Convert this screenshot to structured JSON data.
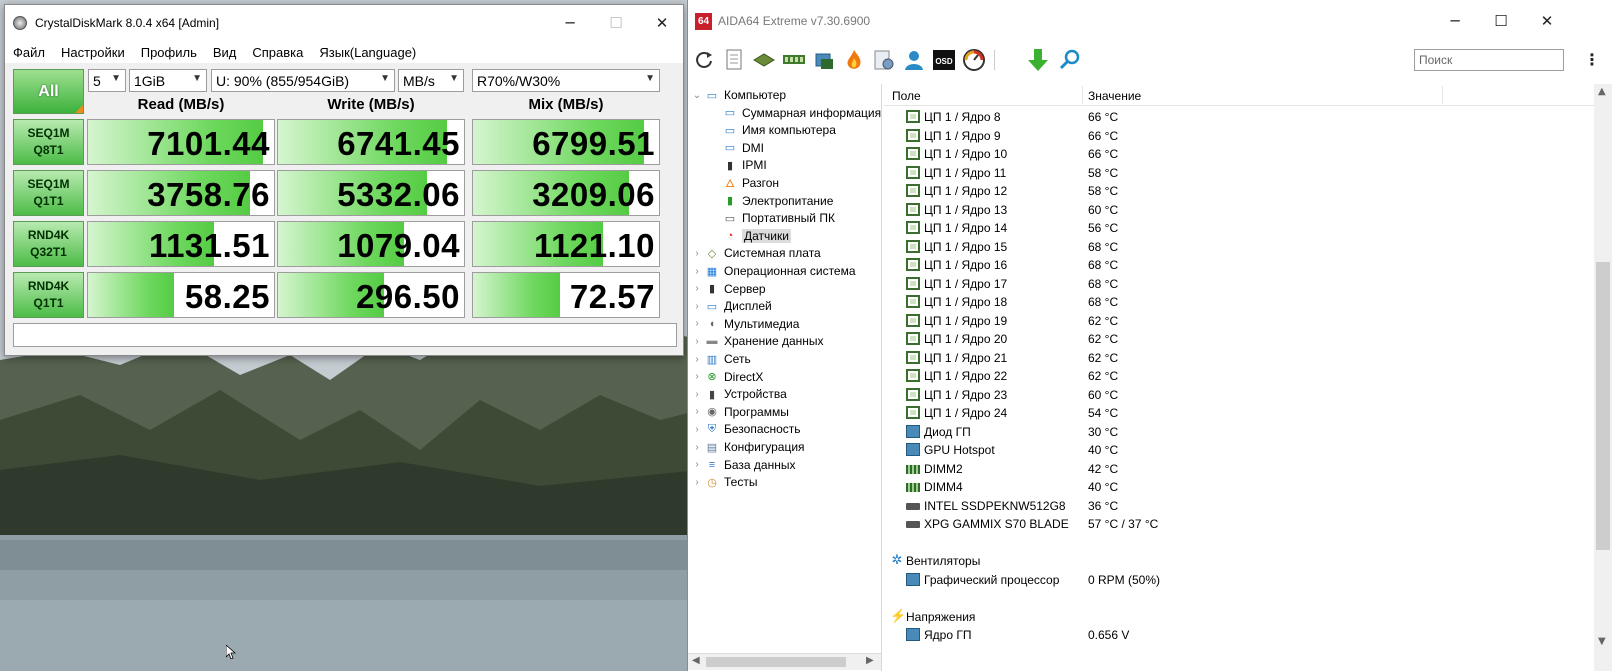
{
  "cdm": {
    "title": "CrystalDiskMark 8.0.4 x64 [Admin]",
    "menu": [
      "Файл",
      "Настройки",
      "Профиль",
      "Вид",
      "Справка",
      "Язык(Language)"
    ],
    "all_label": "All",
    "count": "5",
    "size": "1GiB",
    "drive": "U: 90% (855/954GiB)",
    "unit": "MB/s",
    "profile": "R70%/W30%",
    "columns": [
      "Read (MB/s)",
      "Write (MB/s)",
      "Mix (MB/s)"
    ],
    "rows": [
      {
        "l1": "SEQ1M",
        "l2": "Q8T1",
        "read": "7101.44",
        "write": "6741.45",
        "mix": "6799.51",
        "read_fill": 0.94,
        "write_fill": 0.91,
        "mix_fill": 0.92
      },
      {
        "l1": "SEQ1M",
        "l2": "Q1T1",
        "read": "3758.76",
        "write": "5332.06",
        "mix": "3209.06",
        "read_fill": 0.87,
        "write_fill": 0.8,
        "mix_fill": 0.84
      },
      {
        "l1": "RND4K",
        "l2": "Q32T1",
        "read": "1131.51",
        "write": "1079.04",
        "mix": "1121.10",
        "read_fill": 0.68,
        "write_fill": 0.68,
        "mix_fill": 0.7
      },
      {
        "l1": "RND4K",
        "l2": "Q1T1",
        "read": "58.25",
        "write": "296.50",
        "mix": "72.57",
        "read_fill": 0.46,
        "write_fill": 0.57,
        "mix_fill": 0.47
      }
    ],
    "status": ""
  },
  "aida": {
    "title": "AIDA64 Extreme v7.30.6900",
    "logo": "64",
    "search_placeholder": "Поиск",
    "tree": [
      {
        "label": "Компьютер",
        "level": 0,
        "expanded": true,
        "icon": "computer-icon"
      },
      {
        "label": "Суммарная информация",
        "level": 1,
        "icon": "computer-icon"
      },
      {
        "label": "Имя компьютера",
        "level": 1,
        "icon": "computer-icon"
      },
      {
        "label": "DMI",
        "level": 1,
        "icon": "computer-icon"
      },
      {
        "label": "IPMI",
        "level": 1,
        "icon": "server-icon"
      },
      {
        "label": "Разгон",
        "level": 1,
        "icon": "flame-icon"
      },
      {
        "label": "Электропитание",
        "level": 1,
        "icon": "battery-icon"
      },
      {
        "label": "Портативный ПК",
        "level": 1,
        "icon": "laptop-icon"
      },
      {
        "label": "Датчики",
        "level": 1,
        "icon": "gauge-icon",
        "selected": true
      },
      {
        "label": "Системная плата",
        "level": 0,
        "icon": "motherboard-icon"
      },
      {
        "label": "Операционная система",
        "level": 0,
        "icon": "windows-icon"
      },
      {
        "label": "Сервер",
        "level": 0,
        "icon": "server-icon"
      },
      {
        "label": "Дисплей",
        "level": 0,
        "icon": "monitor-icon"
      },
      {
        "label": "Мультимедиа",
        "level": 0,
        "icon": "speaker-icon"
      },
      {
        "label": "Хранение данных",
        "level": 0,
        "icon": "drive-icon"
      },
      {
        "label": "Сеть",
        "level": 0,
        "icon": "network-icon"
      },
      {
        "label": "DirectX",
        "level": 0,
        "icon": "xbox-icon"
      },
      {
        "label": "Устройства",
        "level": 0,
        "icon": "device-icon"
      },
      {
        "label": "Программы",
        "level": 0,
        "icon": "disc-icon"
      },
      {
        "label": "Безопасность",
        "level": 0,
        "icon": "shield-icon"
      },
      {
        "label": "Конфигурация",
        "level": 0,
        "icon": "config-icon"
      },
      {
        "label": "База данных",
        "level": 0,
        "icon": "database-icon"
      },
      {
        "label": "Тесты",
        "level": 0,
        "icon": "timer-icon"
      }
    ],
    "col_field": "Поле",
    "col_value": "Значение",
    "rows": [
      {
        "f": "ЦП 1 / Ядро 8",
        "v": "66 °C",
        "t": "chip"
      },
      {
        "f": "ЦП 1 / Ядро 9",
        "v": "66 °C",
        "t": "chip"
      },
      {
        "f": "ЦП 1 / Ядро 10",
        "v": "66 °C",
        "t": "chip"
      },
      {
        "f": "ЦП 1 / Ядро 11",
        "v": "58 °C",
        "t": "chip"
      },
      {
        "f": "ЦП 1 / Ядро 12",
        "v": "58 °C",
        "t": "chip"
      },
      {
        "f": "ЦП 1 / Ядро 13",
        "v": "60 °C",
        "t": "chip"
      },
      {
        "f": "ЦП 1 / Ядро 14",
        "v": "56 °C",
        "t": "chip"
      },
      {
        "f": "ЦП 1 / Ядро 15",
        "v": "68 °C",
        "t": "chip"
      },
      {
        "f": "ЦП 1 / Ядро 16",
        "v": "68 °C",
        "t": "chip"
      },
      {
        "f": "ЦП 1 / Ядро 17",
        "v": "68 °C",
        "t": "chip"
      },
      {
        "f": "ЦП 1 / Ядро 18",
        "v": "68 °C",
        "t": "chip"
      },
      {
        "f": "ЦП 1 / Ядро 19",
        "v": "62 °C",
        "t": "chip"
      },
      {
        "f": "ЦП 1 / Ядро 20",
        "v": "62 °C",
        "t": "chip"
      },
      {
        "f": "ЦП 1 / Ядро 21",
        "v": "62 °C",
        "t": "chip"
      },
      {
        "f": "ЦП 1 / Ядро 22",
        "v": "62 °C",
        "t": "chip"
      },
      {
        "f": "ЦП 1 / Ядро 23",
        "v": "60 °C",
        "t": "chip"
      },
      {
        "f": "ЦП 1 / Ядро 24",
        "v": "54 °C",
        "t": "chip"
      },
      {
        "f": "Диод ГП",
        "v": "30 °C",
        "t": "gpu"
      },
      {
        "f": "GPU Hotspot",
        "v": "40 °C",
        "t": "gpu"
      },
      {
        "f": "DIMM2",
        "v": "42 °C",
        "t": "ram"
      },
      {
        "f": "DIMM4",
        "v": "40 °C",
        "t": "ram"
      },
      {
        "f": "INTEL SSDPEKNW512G8",
        "v": "36 °C",
        "t": "ssd"
      },
      {
        "f": "XPG GAMMIX S70 BLADE",
        "v": "57 °C / 37 °C",
        "t": "ssd"
      },
      {
        "f": "",
        "v": "",
        "t": "blank"
      },
      {
        "f": "Вентиляторы",
        "v": "",
        "t": "group-fan"
      },
      {
        "f": "Графический процессор",
        "v": "0 RPM  (50%)",
        "t": "gpu"
      },
      {
        "f": "",
        "v": "",
        "t": "blank"
      },
      {
        "f": "Напряжения",
        "v": "",
        "t": "group-volt"
      },
      {
        "f": "Ядро ГП",
        "v": "0.656 V",
        "t": "gpu"
      }
    ]
  },
  "colors": {
    "accent_green": "#55cc44",
    "aida_red": "#c8202a"
  }
}
